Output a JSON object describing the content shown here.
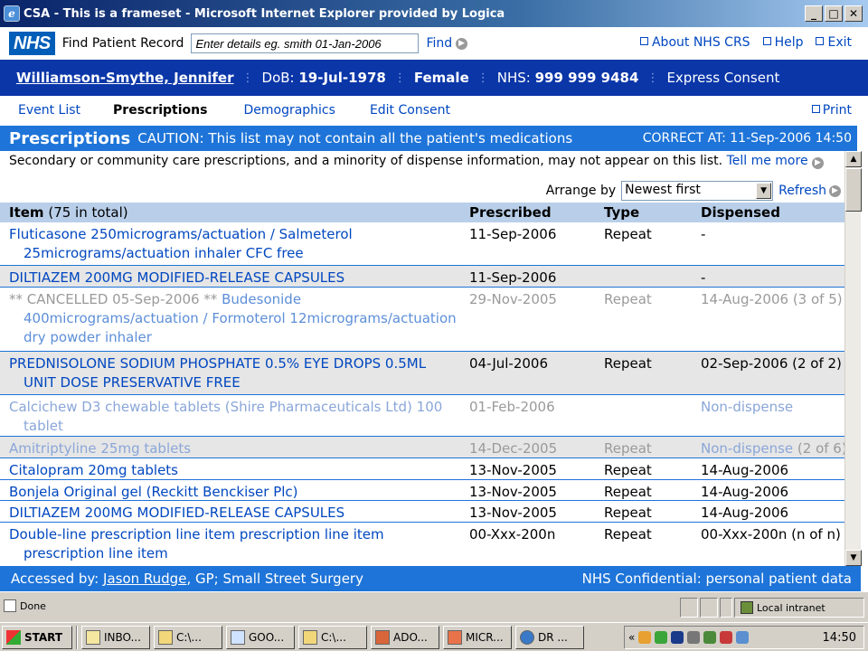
{
  "window": {
    "title": "CSA - This is a frameset - Microsoft Internet Explorer provided by Logica",
    "min_label": "_",
    "max_label": "□",
    "close_label": "✕"
  },
  "header": {
    "logo": "NHS",
    "find_patient_label": "Find Patient Record",
    "search_placeholder": "Enter details eg. smith 01-Jan-2006",
    "find_label": "Find",
    "links": {
      "about": "About NHS CRS",
      "help": "Help",
      "exit": "Exit"
    }
  },
  "patient": {
    "name": "Williamson-Smythe, Jennifer",
    "dob_label": "DoB:",
    "dob": "19-Jul-1978",
    "gender": "Female",
    "nhs_label": "NHS:",
    "nhs_number": "999 999 9484",
    "consent": "Express Consent"
  },
  "nav": {
    "tabs": [
      "Event List",
      "Prescriptions",
      "Demographics",
      "Edit Consent"
    ],
    "active": "Prescriptions",
    "print_label": "Print"
  },
  "section": {
    "title": "Prescriptions",
    "caution": "CAUTION: This list may not contain all the patient's medications",
    "correct_at": "CORRECT AT: 11-Sep-2006  14:50"
  },
  "notice": {
    "text": "Secondary or community care prescriptions, and a minority of dispense information, may not appear on this list.",
    "link": "Tell me more"
  },
  "arrange": {
    "label": "Arrange by",
    "selected": "Newest first",
    "refresh_label": "Refresh"
  },
  "table": {
    "headers": {
      "item": "Item",
      "item_count": "(75 in total)",
      "prescribed": "Prescribed",
      "type": "Type",
      "dispensed": "Dispensed"
    },
    "rows": [
      {
        "item": "Fluticasone 250micrograms/actuation / Salmeterol 25micrograms/actuation inhaler CFC free",
        "prescribed": "11-Sep-2006",
        "type": "Repeat",
        "dispensed": "-"
      },
      {
        "item": "DILTIAZEM 200MG MODIFIED-RELEASE CAPSULES",
        "prescribed": "11-Sep-2006",
        "type": "",
        "dispensed": "-"
      },
      {
        "cancel_prefix": "** CANCELLED 05-Sep-2006 **",
        "item": "Budesonide 400micrograms/actuation / Formoterol 12micrograms/actuation dry powder inhaler",
        "prescribed": "29-Nov-2005",
        "type": "Repeat",
        "dispensed": "14-Aug-2006 (3 of 5)"
      },
      {
        "item": "PREDNISOLONE SODIUM PHOSPHATE 0.5% EYE DROPS 0.5ML UNIT DOSE PRESERVATIVE FREE",
        "prescribed": "04-Jul-2006",
        "type": "Repeat",
        "dispensed": "02-Sep-2006 (2 of 2)"
      },
      {
        "item": "Calcichew D3 chewable tablets (Shire Pharmaceuticals Ltd) 100 tablet",
        "prescribed": "01-Feb-2006",
        "type": "",
        "dispensed": "Non-dispense"
      },
      {
        "item": "Amitriptyline 25mg tablets",
        "prescribed": "14-Dec-2005",
        "type": "Repeat",
        "dispensed": "Non-dispense",
        "dispensed_count": "(2 of 6)"
      },
      {
        "item": "Citalopram 20mg tablets",
        "prescribed": "13-Nov-2005",
        "type": "Repeat",
        "dispensed": "14-Aug-2006"
      },
      {
        "item": "Bonjela Original gel (Reckitt Benckiser Plc)",
        "prescribed": "13-Nov-2005",
        "type": "Repeat",
        "dispensed": "14-Aug-2006"
      },
      {
        "item": "DILTIAZEM 200MG MODIFIED-RELEASE CAPSULES",
        "prescribed": "13-Nov-2005",
        "type": "Repeat",
        "dispensed": "14-Aug-2006"
      },
      {
        "item": "Double-line prescription line item prescription line item prescription line item",
        "prescribed": "00-Xxx-200n",
        "type": "Repeat",
        "dispensed": "00-Xxx-200n (n of n)"
      }
    ]
  },
  "footer": {
    "accessed_label": "Accessed by:",
    "user": "Jason Rudge",
    "user_detail": ", GP; Small Street Surgery",
    "confidential": "NHS Confidential: personal patient data"
  },
  "statusbar": {
    "done": "Done",
    "zone": "Local intranet"
  },
  "taskbar": {
    "start": "START",
    "tasks": [
      "INBO...",
      "C:\\...",
      "GOO...",
      "C:\\...",
      "ADO...",
      "MICR...",
      "DR ..."
    ],
    "clock": "14:50"
  }
}
